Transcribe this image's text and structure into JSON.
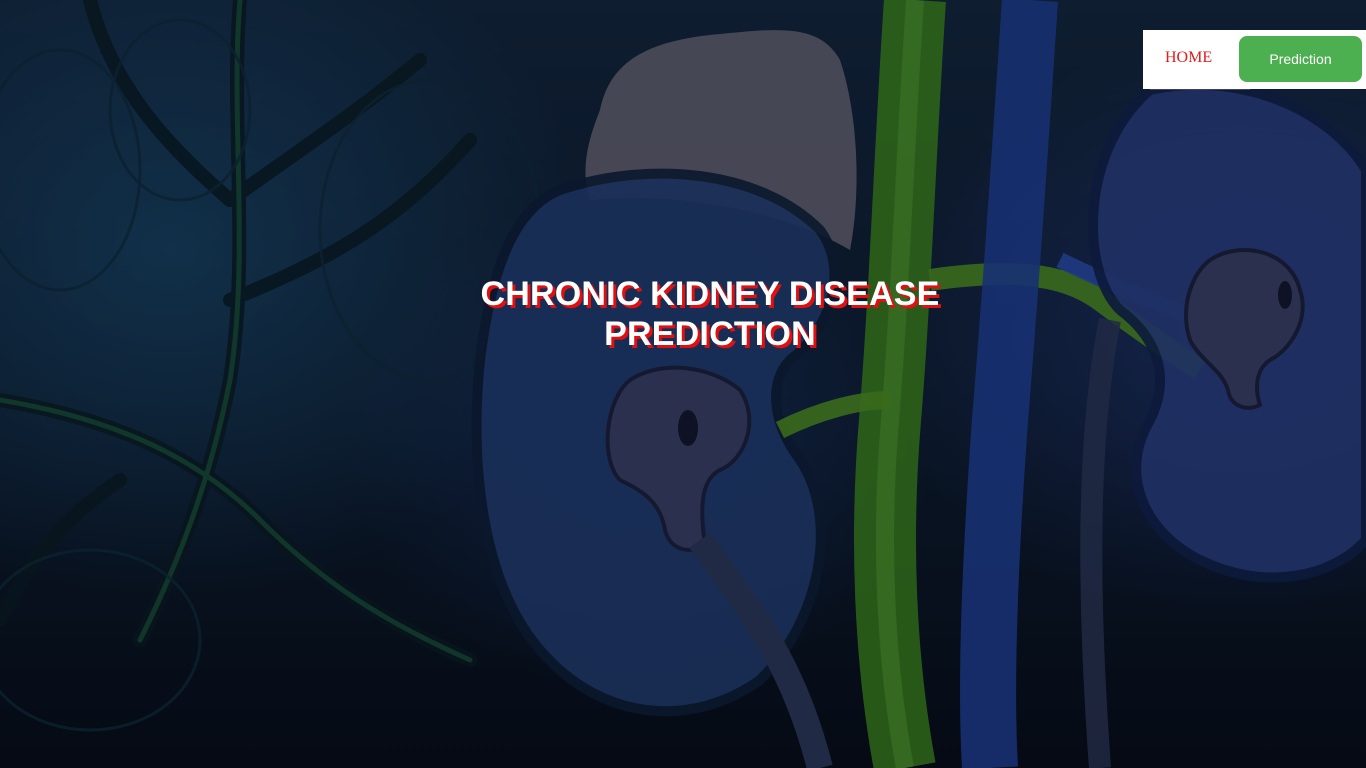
{
  "nav": {
    "home_label": "HOME",
    "prediction_label": "Prediction"
  },
  "hero": {
    "title": "CHRONIC KIDNEY DISEASE PREDICTION",
    "background": "kidney-anatomy-illustration"
  },
  "colors": {
    "home_link": "#e21b1b",
    "prediction_button": "#4caf50",
    "title_text": "#ffffff",
    "title_shadow": "#e01010"
  }
}
